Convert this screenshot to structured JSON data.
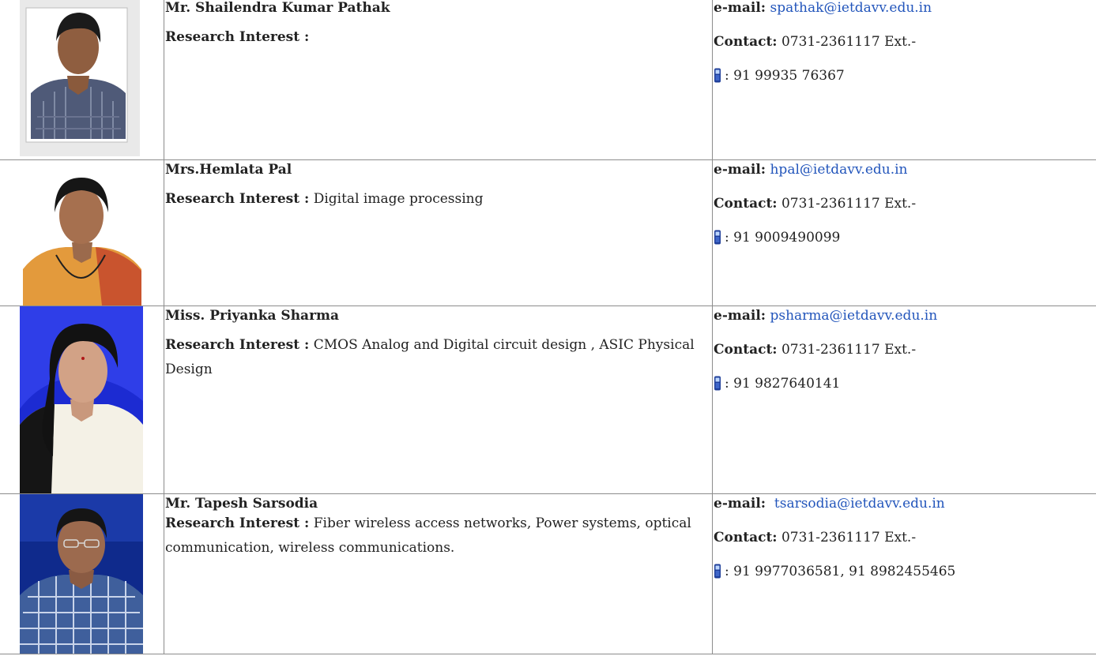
{
  "labels": {
    "research": "Research Interest :",
    "email": "e-mail:",
    "contact": "Contact:",
    "mobile_prefix": ": 91 "
  },
  "icon": "mobile-phone-icon",
  "link_color": "#2255bb",
  "faculty": [
    {
      "name": "Mr. Shailendra Kumar Pathak",
      "research": "",
      "email": "spathak@ietdavv.edu.in",
      "contact": "0731-2361117 Ext.-",
      "mobile": "99935 76367"
    },
    {
      "name": "Mrs.Hemlata Pal",
      "research": "Digital image processing",
      "email": "hpal@ietdavv.edu.in",
      "contact": "0731-2361117 Ext.-",
      "mobile": "9009490099"
    },
    {
      "name": "Miss. Priyanka Sharma",
      "research": "CMOS Analog and Digital circuit design , ASIC Physical Design",
      "email": "psharma@ietdavv.edu.in",
      "contact": "0731-2361117 Ext.-",
      "mobile": "9827640141"
    },
    {
      "name": "Mr. Tapesh Sarsodia",
      "research": "Fiber wireless access networks, Power systems, optical communication, wireless communications.",
      "email": "tsarsodia@ietdavv.edu.in",
      "contact": "0731-2361117 Ext.-",
      "mobile": "9977036581, 91 8982455465"
    }
  ]
}
